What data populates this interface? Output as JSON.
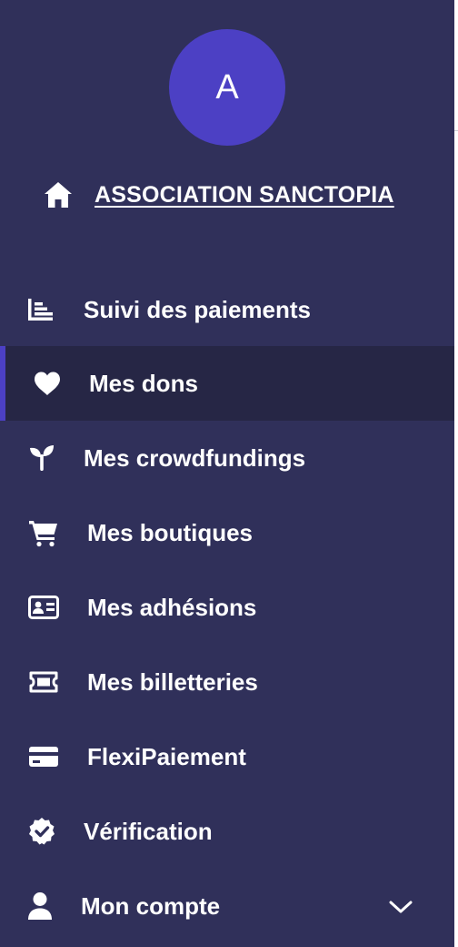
{
  "avatar": {
    "initial": "A",
    "color": "#4c40c4"
  },
  "organization": {
    "name": "ASSOCIATION SANCTOPIA",
    "icon": "home-icon"
  },
  "nav": {
    "items": [
      {
        "label": "Suivi des paiements",
        "icon": "chart-icon",
        "active": false
      },
      {
        "label": "Mes dons",
        "icon": "heart-icon",
        "active": true
      },
      {
        "label": "Mes crowdfundings",
        "icon": "sprout-icon",
        "active": false
      },
      {
        "label": "Mes boutiques",
        "icon": "cart-icon",
        "active": false
      },
      {
        "label": "Mes adhésions",
        "icon": "id-card-icon",
        "active": false
      },
      {
        "label": "Mes billetteries",
        "icon": "ticket-icon",
        "active": false
      },
      {
        "label": "FlexiPaiement",
        "icon": "credit-card-icon",
        "active": false
      },
      {
        "label": "Vérification",
        "icon": "verified-badge-icon",
        "active": false
      },
      {
        "label": "Mon compte",
        "icon": "user-icon",
        "active": false,
        "expandable": true
      }
    ]
  },
  "colors": {
    "sidebar_background": "#30305a",
    "active_background": "#262645",
    "accent": "#4c40c4",
    "text": "#ffffff"
  }
}
